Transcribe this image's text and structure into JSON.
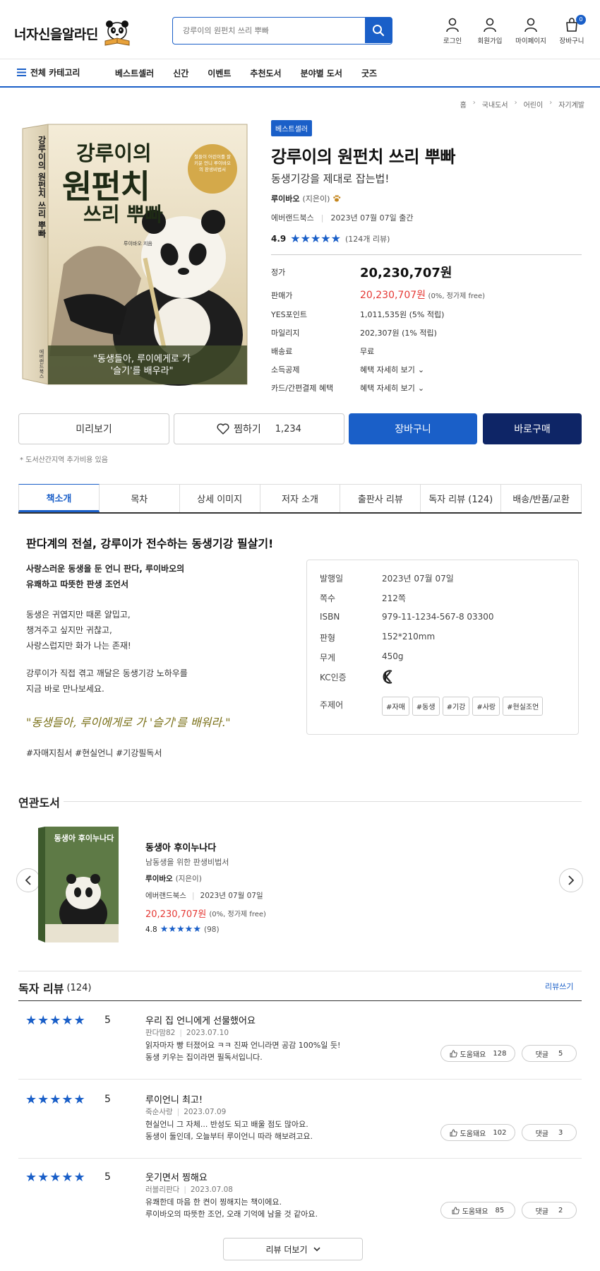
{
  "header": {
    "logo_text": "너자신을알라딘",
    "search_placeholder": "강루이의 원펀치 쓰리 뿌빠",
    "utils": [
      {
        "label": "로그인",
        "icon": "person-icon"
      },
      {
        "label": "회원가입",
        "icon": "person-add-icon"
      },
      {
        "label": "마이페이지",
        "icon": "person-icon"
      },
      {
        "label": "장바구니",
        "icon": "cart-icon"
      }
    ],
    "cart_count": "0"
  },
  "gnb": {
    "all_label": "전체 카테고리",
    "menu": [
      "베스트셀러",
      "신간",
      "이벤트",
      "추천도서",
      "분야별 도서",
      "굿즈"
    ]
  },
  "breadcrumb": [
    "홈",
    "국내도서",
    "어린이",
    "자기계발"
  ],
  "cover": {
    "title_line1": "강루이의",
    "title_line2": "원펀치",
    "title_line3": "쓰리 뿌빠",
    "badge": "철들이 어린이를 잘 키운 언니 루이바오의 판생비법서",
    "author": "루이바오 지음",
    "caption1": "\"동생들아, 루이에게로 가",
    "caption2": "'슬기'를 배우라\"",
    "spine_title": "강루이의 원펀치 쓰리 뿌빠",
    "spine_pub": "에버랜드북스"
  },
  "product": {
    "badge": "베스트셀러",
    "title": "강루이의 원펀치 쓰리 뿌빠",
    "subtitle": "동생기강을 제대로 잡는법!",
    "author": "루이바오",
    "author_role": "(지은이)",
    "publisher": "에버랜드북스",
    "pub_date": "2023년 07월 07일 출간",
    "rating": "4.9",
    "review_count": "(124개 리뷰)",
    "stars": "★★★★★"
  },
  "price": {
    "list_label": "정가",
    "list_value": "20,230,707원",
    "sale_label": "판매가",
    "sale_value": "20,230,707원",
    "sale_note": "(0%, 정가제 free)",
    "rows": [
      {
        "label": "YES포인트",
        "value": "1,011,535원 (5% 적립)"
      },
      {
        "label": "마일리지",
        "value": "202,307원 (1% 적립)"
      },
      {
        "label": "배송료",
        "value": "무료"
      },
      {
        "label": "소득공제",
        "value": "혜택 자세히 보기"
      },
      {
        "label": "카드/간편결제 혜택",
        "value": "혜택 자세히 보기"
      }
    ]
  },
  "actions": {
    "preview": "미리보기",
    "wish": "찜하기",
    "wish_count": "1,234",
    "cart": "장바구니",
    "buy": "바로구매",
    "note": "* 도서산간지역 추가비용 있음"
  },
  "tabs": [
    "책소개",
    "목차",
    "상세 이미지",
    "저자 소개",
    "출판사 리뷰",
    "독자 리뷰 (124)",
    "배송/반품/교환"
  ],
  "intro": {
    "headline": "판다계의 전설, 강루이가 전수하는 동생기강 필살기!",
    "p1_l1": "사랑스러운 동생을 둔 언니 판다, 루이바오의",
    "p1_l2": "유쾌하고 따뜻한 판생 조언서",
    "p2_l1": "동생은 귀엽지만 때론 얄밉고,",
    "p2_l2": "챙겨주고 싶지만 귀찮고,",
    "p2_l3": "사랑스럽지만 화가 나는 존재!",
    "p3_l1": "강루이가 직접 겪고 깨달은 동생기강 노하우를",
    "p3_l2": "지금 바로 만나보세요.",
    "quote": "\"동생들아, 루이에게로 가 '슬기'를 배워라.\"",
    "hashtags": "#자매지침서 #현실언니 #기강필독서"
  },
  "spec": {
    "rows": [
      {
        "label": "발행일",
        "value": "2023년 07월 07일"
      },
      {
        "label": "쪽수",
        "value": "212쪽"
      },
      {
        "label": "ISBN",
        "value": "979-11-1234-567-8 03300"
      },
      {
        "label": "판형",
        "value": "152*210mm"
      },
      {
        "label": "무게",
        "value": "450g"
      }
    ],
    "kc_label": "KC인증",
    "topic_label": "주제어",
    "topics": [
      "#자매",
      "#동생",
      "#기강",
      "#사랑",
      "#현실조언"
    ]
  },
  "related": {
    "section_title": "연관도서",
    "cover_title": "동생아 후이누나다",
    "title": "동생아 후이누나다",
    "subtitle": "남동생을 위한 판생비법서",
    "author": "루이바오",
    "author_role": "(지은이)",
    "publisher": "에버랜드북스",
    "date": "2023년 07월 07일",
    "price": "20,230,707원",
    "price_note": "(0%, 정가제 free)",
    "rating": "4.8",
    "stars": "★★★★★",
    "count": "(98)"
  },
  "reviews": {
    "section_title": "독자 리뷰",
    "count": "(124)",
    "write_label": "리뷰쓰기",
    "help_label": "도움돼요",
    "comment_label": "댓글",
    "more_label": "리뷰 더보기",
    "items": [
      {
        "stars": "★★★★★",
        "score": "5",
        "title": "우리 집 언니에게 선물했어요",
        "user": "판다맘82",
        "date": "2023.07.10",
        "line1": "읽자마자 빵 터졌어요 ㅋㅋ 진짜 언니라면 공감 100%일 듯!",
        "line2": "동생 키우는 집이라면 필독서입니다.",
        "help": "128",
        "comments": "5"
      },
      {
        "stars": "★★★★★",
        "score": "5",
        "title": "루이언니 최고!",
        "user": "죽순사랑",
        "date": "2023.07.09",
        "line1": "현실언니 그 자체... 반성도 되고 배울 점도 많아요.",
        "line2": "동생이 둘인데, 오늘부터 루이언니 따라 해보려고요.",
        "help": "102",
        "comments": "3"
      },
      {
        "stars": "★★★★★",
        "score": "5",
        "title": "웃기면서 찡해요",
        "user": "러블리판다",
        "date": "2023.07.08",
        "line1": "유쾌한데 마음 한 켠이 찡해지는 책이에요.",
        "line2": "루이바오의 따뜻한 조언, 오래 기억에 남을 것 같아요.",
        "help": "85",
        "comments": "2"
      }
    ]
  },
  "colors": {
    "accent": "#1a5fc8",
    "buy": "#0e2566",
    "sale": "#e53935"
  }
}
